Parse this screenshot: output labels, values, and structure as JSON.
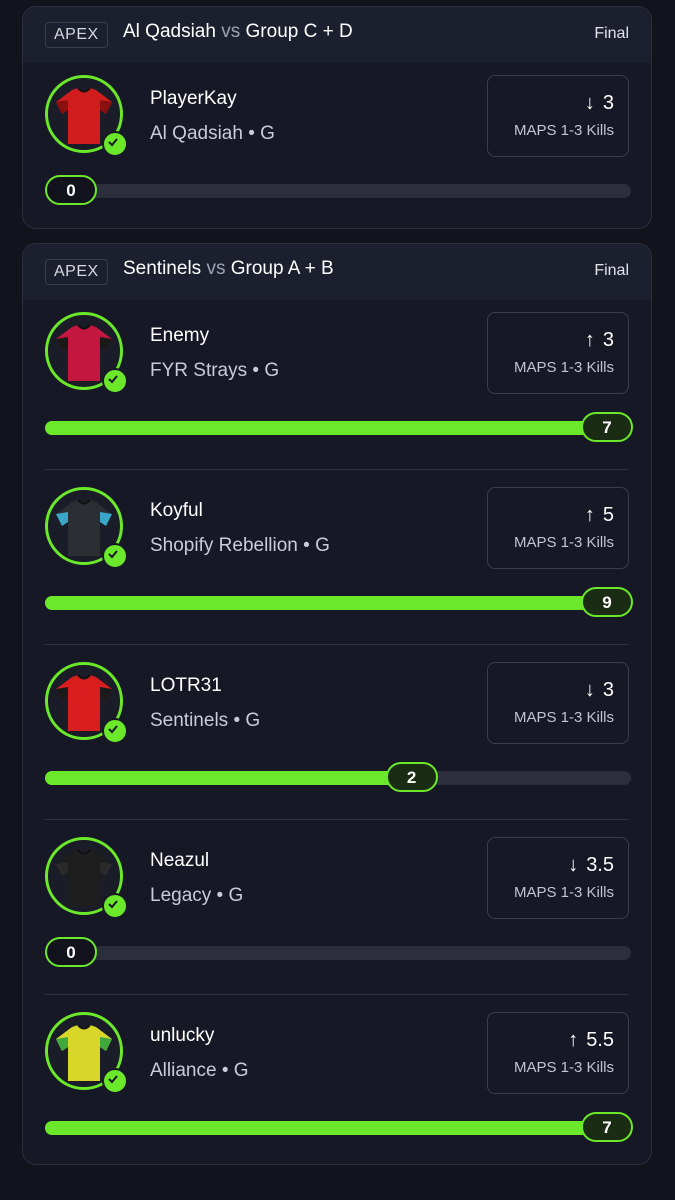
{
  "cards": [
    {
      "tag": "APEX",
      "team_a": "Al Qadsiah",
      "vs": "vs",
      "team_b": "Group C + D",
      "status": "Final",
      "players": [
        {
          "name": "PlayerKay",
          "team_line": "Al Qadsiah • G",
          "direction": "down",
          "arrow": "↓",
          "line": "3",
          "market": "MAPS 1-3 Kills",
          "result": "0",
          "progress_fraction": 0.0,
          "jersey_colors": [
            "#d01c1c",
            "#8a0f0f"
          ]
        }
      ]
    },
    {
      "tag": "APEX",
      "team_a": "Sentinels",
      "vs": "vs",
      "team_b": "Group A + B",
      "status": "Final",
      "players": [
        {
          "name": "Enemy",
          "team_line": "FYR Strays • G",
          "direction": "up",
          "arrow": "↑",
          "line": "3",
          "market": "MAPS 1-3 Kills",
          "result": "7",
          "progress_fraction": 1.0,
          "jersey_colors": [
            "#c4173f",
            "#1a1a1a"
          ]
        },
        {
          "name": "Koyful",
          "team_line": "Shopify Rebellion • G",
          "direction": "up",
          "arrow": "↑",
          "line": "5",
          "market": "MAPS 1-3 Kills",
          "result": "9",
          "progress_fraction": 1.0,
          "jersey_colors": [
            "#2b2e33",
            "#3aa6c9"
          ]
        },
        {
          "name": "LOTR31",
          "team_line": "Sentinels • G",
          "direction": "down",
          "arrow": "↓",
          "line": "3",
          "market": "MAPS 1-3 Kills",
          "result": "2",
          "progress_fraction": 0.67,
          "jersey_colors": [
            "#d81e1e",
            "#1a1a1a"
          ]
        },
        {
          "name": "Neazul",
          "team_line": "Legacy • G",
          "direction": "down",
          "arrow": "↓",
          "line": "3.5",
          "market": "MAPS 1-3 Kills",
          "result": "0",
          "progress_fraction": 0.0,
          "jersey_colors": [
            "#1e1e1e",
            "#2a2a2a"
          ]
        },
        {
          "name": "unlucky",
          "team_line": "Alliance • G",
          "direction": "up",
          "arrow": "↑",
          "line": "5.5",
          "market": "MAPS 1-3 Kills",
          "result": "7",
          "progress_fraction": 1.0,
          "jersey_colors": [
            "#d9d62a",
            "#3fa83f"
          ]
        }
      ]
    }
  ],
  "colors": {
    "accent": "#6be82a",
    "background": "#12131c",
    "card": "#161825"
  }
}
